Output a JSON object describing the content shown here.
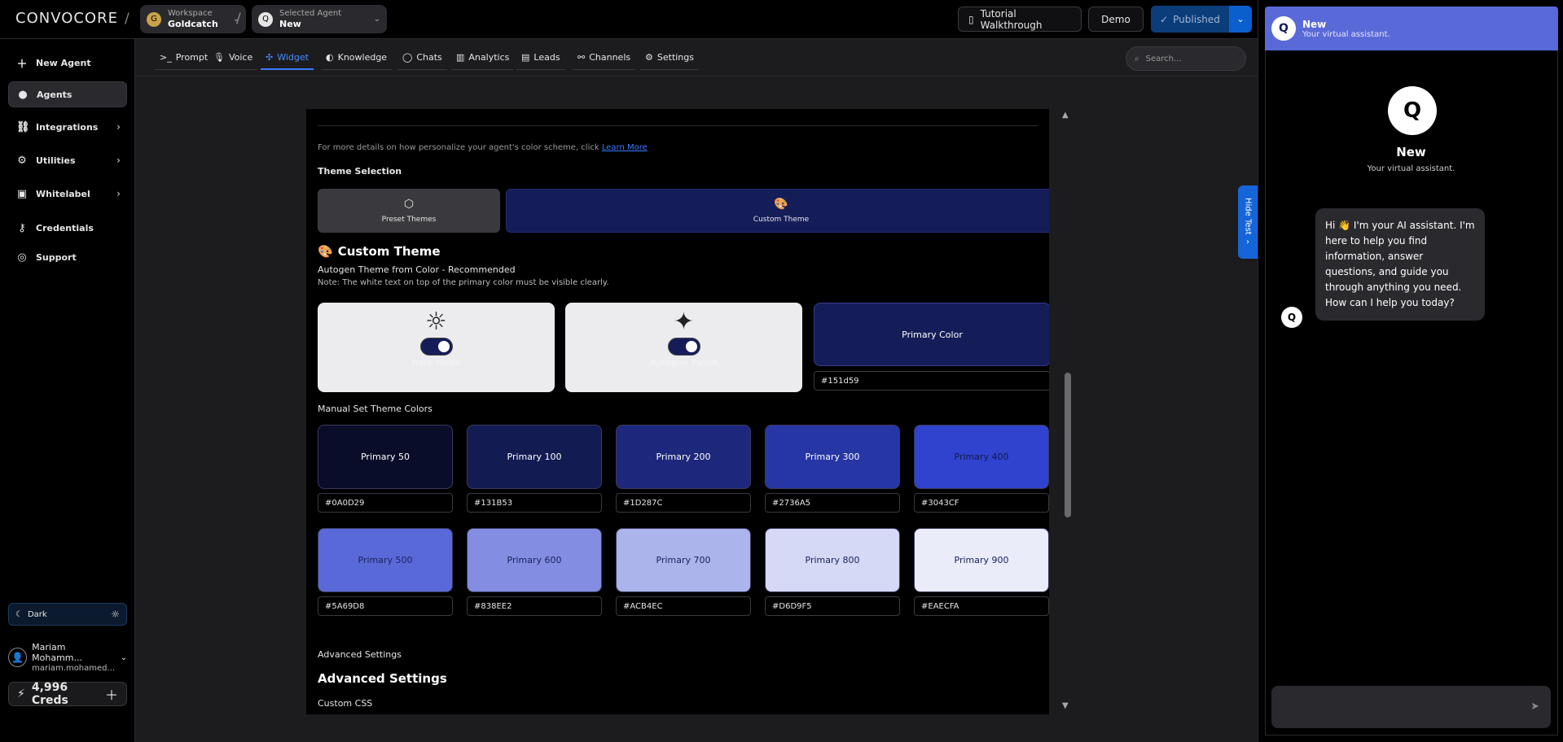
{
  "header": {
    "logo": "CONVOCORE",
    "workspace_label": "Workspace",
    "workspace_name": "Goldcatch",
    "agent_label": "Selected Agent",
    "agent_name": "New",
    "tutorial": "Tutorial Walkthrough",
    "demo": "Demo",
    "published": "Published"
  },
  "sidebar": {
    "items": [
      {
        "label": "New Agent",
        "icon": "plus-icon"
      },
      {
        "label": "Agents",
        "icon": "agent-icon"
      },
      {
        "label": "Integrations",
        "icon": "link-icon"
      },
      {
        "label": "Utilities",
        "icon": "gear-icon"
      },
      {
        "label": "Whitelabel",
        "icon": "person-badge-icon"
      },
      {
        "label": "Credentials",
        "icon": "key-icon"
      },
      {
        "label": "Support",
        "icon": "lifebuoy-icon"
      }
    ],
    "theme": "Dark",
    "user_name": "Mariam Mohamm...",
    "user_email": "mariam.mohamed...",
    "creds": "4,996 Creds"
  },
  "tabs": [
    {
      "label": "Prompt",
      "icon": "terminal-icon"
    },
    {
      "label": "Voice",
      "icon": "mic-icon"
    },
    {
      "label": "Widget",
      "icon": "widget-icon"
    },
    {
      "label": "Knowledge",
      "icon": "brain-icon"
    },
    {
      "label": "Chats",
      "icon": "chat-icon"
    },
    {
      "label": "Analytics",
      "icon": "chart-icon"
    },
    {
      "label": "Leads",
      "icon": "contact-icon"
    },
    {
      "label": "Channels",
      "icon": "channels-icon"
    },
    {
      "label": "Settings",
      "icon": "gear-icon"
    }
  ],
  "search_placeholder": "Search...",
  "main": {
    "hint_text": "For more details on how personalize your agent's color scheme, click",
    "hint_link": "Learn More",
    "theme_selection": "Theme Selection",
    "preset_themes": "Preset Themes",
    "custom_theme_btn": "Custom Theme",
    "custom_theme_heading": "Custom Theme",
    "autogen_heading": "Autogen Theme from Color - Recommended",
    "note": "Note: The white text on top of the primary color must be visible clearly.",
    "dark_mode": "Dark Mode",
    "autogen_pallet": "Autogen Pallet",
    "primary_color": "Primary Color",
    "primary_hex": "#151d59",
    "manual_heading": "Manual Set Theme Colors",
    "swatches": [
      {
        "label": "Primary 50",
        "hex": "#0A0D29",
        "bg": "#0a0d29",
        "fg": "#ffffff"
      },
      {
        "label": "Primary 100",
        "hex": "#131B53",
        "bg": "#131b53",
        "fg": "#ffffff"
      },
      {
        "label": "Primary 200",
        "hex": "#1D287C",
        "bg": "#1d287c",
        "fg": "#ffffff"
      },
      {
        "label": "Primary 300",
        "hex": "#2736A5",
        "bg": "#2736a5",
        "fg": "#ffffff"
      },
      {
        "label": "Primary 400",
        "hex": "#3043CF",
        "bg": "#3043cf",
        "fg": "#111a4a"
      },
      {
        "label": "Primary 500",
        "hex": "#5A69D8",
        "bg": "#5a69d8",
        "fg": "#1a2360"
      },
      {
        "label": "Primary 600",
        "hex": "#838EE2",
        "bg": "#838ee2",
        "fg": "#1a2360"
      },
      {
        "label": "Primary 700",
        "hex": "#ACB4EC",
        "bg": "#acb4ec",
        "fg": "#1a2360"
      },
      {
        "label": "Primary 800",
        "hex": "#D6D9F5",
        "bg": "#d6d9f5",
        "fg": "#1a2360"
      },
      {
        "label": "Primary 900",
        "hex": "#EAECFA",
        "bg": "#eaecfa",
        "fg": "#1a2360"
      }
    ],
    "advanced_small": "Advanced Settings",
    "advanced_large": "Advanced Settings",
    "custom_css": "Custom CSS"
  },
  "hide_test": "Hide Test",
  "chat": {
    "name": "New",
    "subtitle": "Your virtual assistant.",
    "message": "Hi 👋 I'm your AI assistant. I'm here to help you find information, answer questions, and guide you through anything you need. How can I help you today?"
  }
}
